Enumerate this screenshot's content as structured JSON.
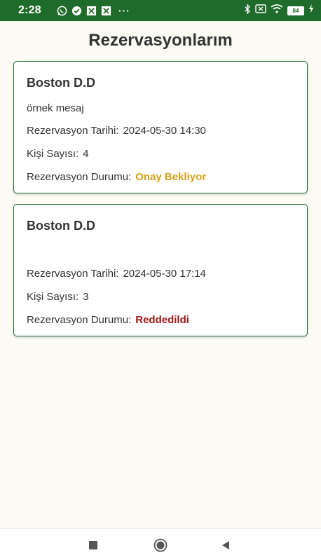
{
  "status_bar": {
    "time": "2:28",
    "battery": "84",
    "notification_more": "···",
    "icons": [
      "whatsapp-icon",
      "check-circle-icon",
      "app-icon",
      "app-icon",
      "bluetooth-icon",
      "sim-icon",
      "wifi-icon",
      "battery-icon",
      "charging-icon"
    ]
  },
  "page": {
    "title": "Rezervasyonlarım"
  },
  "reservations": [
    {
      "name": "Boston D.D",
      "message": "örnek mesaj",
      "date_label": "Rezervasyon Tarihi:",
      "date_value": "2024-05-30 14:30",
      "people_label": "Kişi Sayısı:",
      "people_value": "4",
      "status_label": "Rezervasyon Durumu:",
      "status_value": "Onay Bekliyor",
      "status_color": "#d4a017"
    },
    {
      "name": "Boston D.D",
      "message": "",
      "date_label": "Rezervasyon Tarihi:",
      "date_value": "2024-05-30 17:14",
      "people_label": "Kişi Sayısı:",
      "people_value": "3",
      "status_label": "Rezervasyon Durumu:",
      "status_value": "Reddedildi",
      "status_color": "#a01818"
    }
  ],
  "colors": {
    "accent": "#1f6b2c",
    "background": "#fbfbf4"
  }
}
